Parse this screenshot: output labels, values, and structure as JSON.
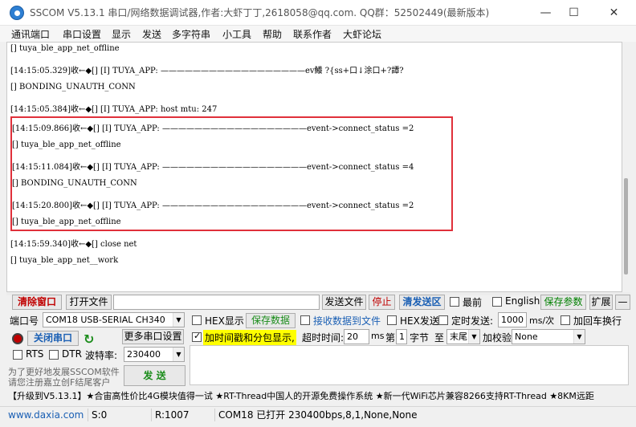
{
  "window": {
    "title": "SSCOM V5.13.1 串口/网络数据调试器,作者:大虾丁丁,2618058@qq.com. QQ群：52502449(最新版本)",
    "minimize": "—",
    "maximize": "☐",
    "close": "✕"
  },
  "menu": [
    "通讯端口",
    "串口设置",
    "显示",
    "发送",
    "多字符串",
    "小工具",
    "帮助",
    "联系作者",
    "大虾论坛"
  ],
  "log": [
    "[] tuya_ble_app_net_offline",
    "[14:15:05.329]收←◆[] [I] TUYA_APP: ——————————————————ev鱶  ?{ss+口↓涂口+?譚?",
    "[] BONDING_UNAUTH_CONN",
    "[14:15:05.384]收←◆[] [I] TUYA_APP: host mtu: 247",
    "[14:15:09.866]收←◆[] [I] TUYA_APP: ——————————————————event->connect_status =2",
    "[] tuya_ble_app_net_offline",
    "[14:15:11.084]收←◆[] [I] TUYA_APP: ——————————————————event->connect_status =4",
    "[] BONDING_UNAUTH_CONN",
    "[14:15:20.800]收←◆[] [I] TUYA_APP: ——————————————————event->connect_status =2",
    "[] tuya_ble_app_net_offline",
    "[14:15:59.340]收←◆[] close net",
    "[]  tuya_ble_app_net__work"
  ],
  "toolbar": {
    "clear_window": "清除窗口",
    "open_file": "打开文件",
    "file_path": "",
    "send_file": "发送文件",
    "stop": "停止",
    "clear_send": "清发送区",
    "topmost": "最前",
    "english": "English",
    "save_params": "保存参数",
    "expand": "扩展",
    "collapse": "—"
  },
  "port": {
    "label": "端口号",
    "value": "COM18 USB-SERIAL CH340",
    "more_settings": "更多串口设置",
    "close_port": "关闭串口",
    "rts": "RTS",
    "dtr": "DTR",
    "baud_label": "波特率:",
    "baud_value": "230400"
  },
  "options": {
    "hex_display": "HEX显示",
    "save_data": "保存数据",
    "recv_to_file": "接收数据到文件",
    "hex_send": "HEX发送",
    "timed_send": "定时发送:",
    "timed_value": "1000",
    "timed_unit": "ms/次",
    "add_crlf": "加回车换行",
    "timestamp": "加时间戳和分包显示,",
    "timeout_label": "超时时间:",
    "timeout_value": "20",
    "timeout_unit": "ms",
    "byte_nth": "第",
    "byte_from": "1",
    "byte_label": "字节",
    "to_label": "至",
    "to_value": "末尾",
    "checksum_label": "加校验",
    "checksum_value": "None"
  },
  "promo": {
    "line1": "为了更好地发展SSCOM软件",
    "line2": "请您注册嘉立创F结尾客户",
    "send_button": "发 送"
  },
  "ticker": "【升级到V5.13.1】★合宙高性价比4G模块值得一试 ★RT-Thread中国人的开源免费操作系统 ★新一代WiFi芯片兼容8266支持RT-Thread ★8KM远距",
  "status": {
    "website": "www.daxia.com",
    "s": "S:0",
    "r": "R:1007",
    "port_status": "COM18 已打开  230400bps,8,1,None,None"
  },
  "colors": {
    "highlight_border": "#e0303a",
    "close_port_text": "#1a5fb4",
    "timestamp_bg": "#ffff00"
  }
}
